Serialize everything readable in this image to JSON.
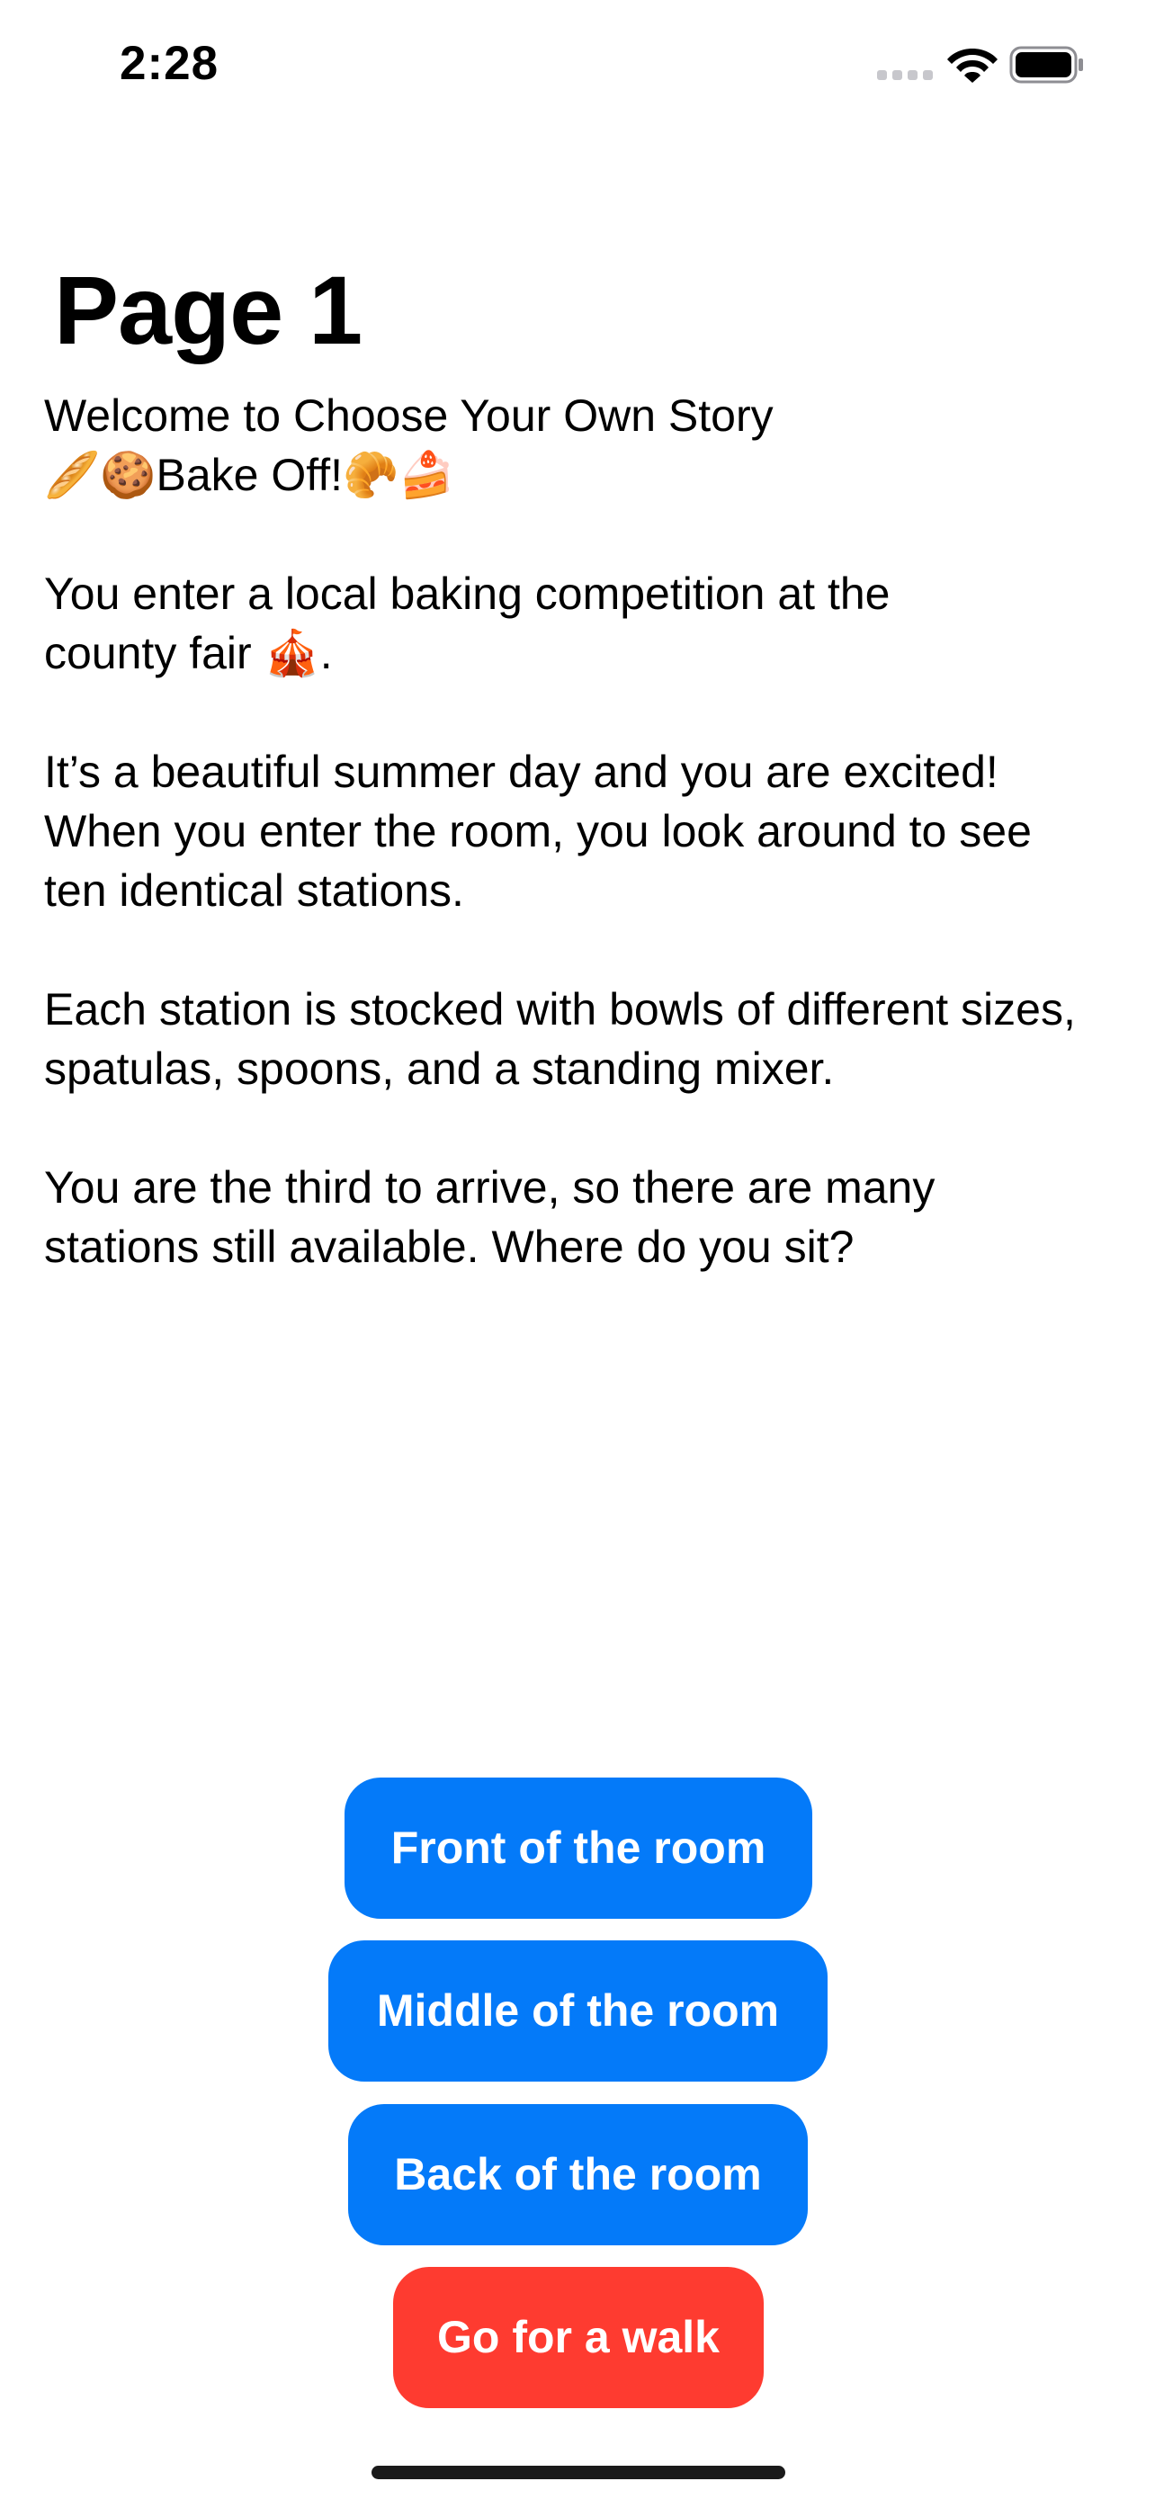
{
  "status_bar": {
    "time": "2:28"
  },
  "page": {
    "title": "Page 1"
  },
  "story": {
    "paragraphs": [
      "Welcome to Choose Your Own Story\n🥖🍪Bake Off!🥐🍰",
      "You enter a local baking competition at the\ncounty fair 🎪.",
      "It’s a beautiful summer day and you are excited!\nWhen you enter the room, you look around to see\nten identical stations.",
      "Each station is stocked with bowls of different sizes,\nspatulas, spoons, and a standing mixer.",
      "You are the third to arrive, so there are many\nstations still available. Where do you sit?"
    ]
  },
  "choices": [
    {
      "label": "Front of the room",
      "color": "#047af9"
    },
    {
      "label": "Middle of the room",
      "color": "#047af9"
    },
    {
      "label": "Back of the room",
      "color": "#047af9"
    },
    {
      "label": "Go for a walk",
      "color": "#fe3b30"
    }
  ],
  "icons": {
    "signal": "cellular-signal-icon",
    "wifi": "wifi-icon",
    "battery": "battery-icon"
  }
}
